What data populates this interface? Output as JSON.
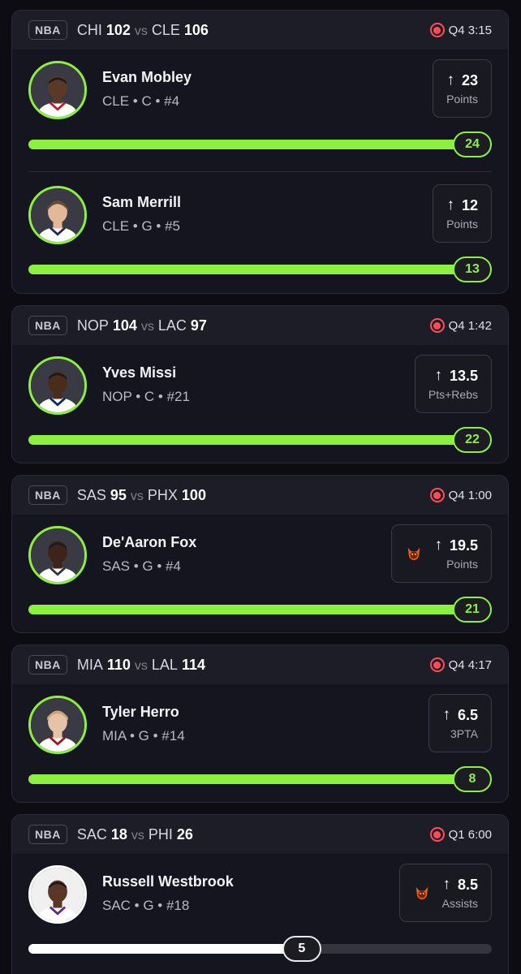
{
  "cards": [
    {
      "league": "NBA",
      "away_team": "CHI",
      "away_score": "102",
      "home_team": "CLE",
      "home_score": "106",
      "vs": "vs",
      "status": "Q4 3:15",
      "players": [
        {
          "name": "Evan Mobley",
          "meta": "CLE • C • #4",
          "line": "23",
          "stat": "Points",
          "current": "24",
          "progress": 1.0,
          "demon": false,
          "bar_color": "#8df03f"
        },
        {
          "name": "Sam Merrill",
          "meta": "CLE • G • #5",
          "line": "12",
          "stat": "Points",
          "current": "13",
          "progress": 1.0,
          "demon": false,
          "bar_color": "#8df03f"
        }
      ]
    },
    {
      "league": "NBA",
      "away_team": "NOP",
      "away_score": "104",
      "home_team": "LAC",
      "home_score": "97",
      "vs": "vs",
      "status": "Q4 1:42",
      "players": [
        {
          "name": "Yves Missi",
          "meta": "NOP • C • #21",
          "line": "13.5",
          "stat": "Pts+Rebs",
          "current": "22",
          "progress": 1.0,
          "demon": false,
          "bar_color": "#8df03f"
        }
      ]
    },
    {
      "league": "NBA",
      "away_team": "SAS",
      "away_score": "95",
      "home_team": "PHX",
      "home_score": "100",
      "vs": "vs",
      "status": "Q4 1:00",
      "players": [
        {
          "name": "De'Aaron Fox",
          "meta": "SAS • G • #4",
          "line": "19.5",
          "stat": "Points",
          "current": "21",
          "progress": 1.0,
          "demon": true,
          "bar_color": "#8df03f"
        }
      ]
    },
    {
      "league": "NBA",
      "away_team": "MIA",
      "away_score": "110",
      "home_team": "LAL",
      "home_score": "114",
      "vs": "vs",
      "status": "Q4 4:17",
      "players": [
        {
          "name": "Tyler Herro",
          "meta": "MIA • G • #14",
          "line": "6.5",
          "stat": "3PTA",
          "current": "8",
          "progress": 1.0,
          "demon": false,
          "bar_color": "#8df03f"
        }
      ]
    },
    {
      "league": "NBA",
      "away_team": "SAC",
      "away_score": "18",
      "home_team": "PHI",
      "home_score": "26",
      "vs": "vs",
      "status": "Q1 6:00",
      "players": [
        {
          "name": "Russell Westbrook",
          "meta": "SAC • G • #18",
          "line": "8.5",
          "stat": "Assists",
          "current": "5",
          "progress": 0.59,
          "demon": true,
          "bar_color": "#ffffff"
        }
      ]
    }
  ],
  "icons": {
    "up_arrow": "↑",
    "live": "live-indicator-icon",
    "demon": "demon-icon"
  },
  "colors": {
    "accent_green": "#8df03f",
    "live_red": "#ff4d57",
    "card_bg": "#15151f"
  }
}
